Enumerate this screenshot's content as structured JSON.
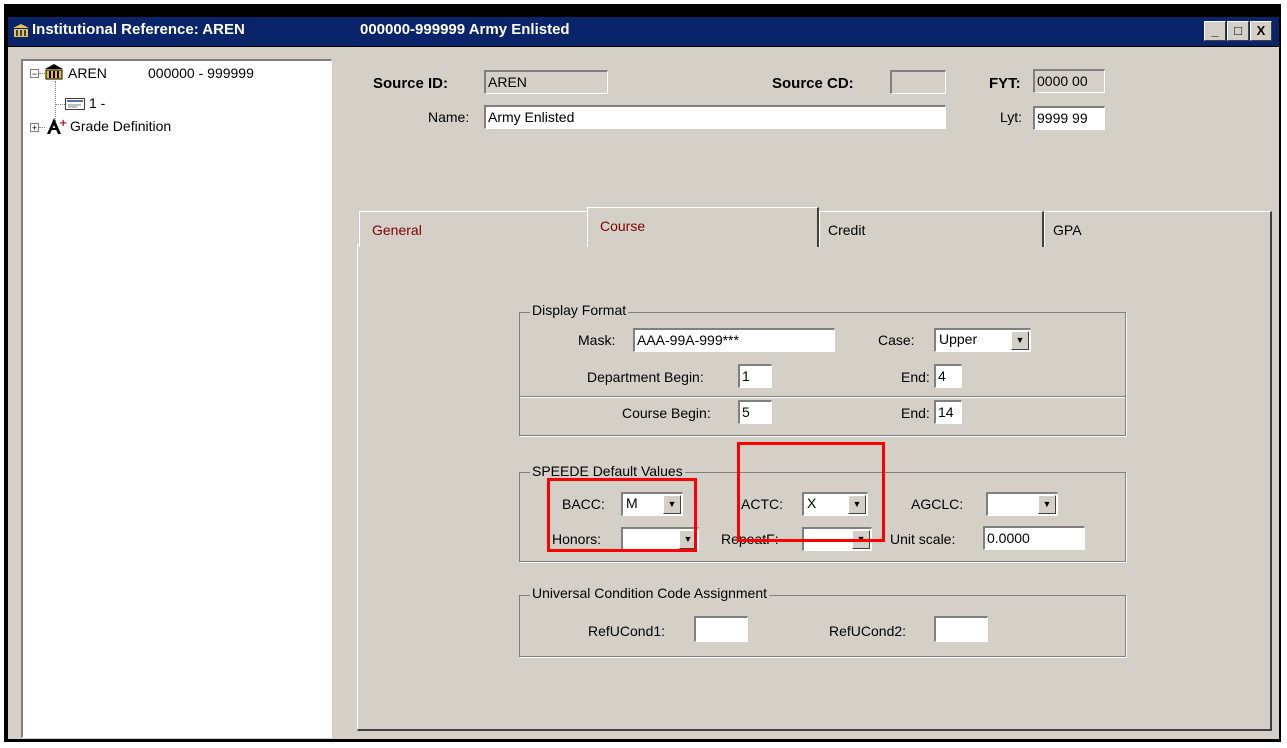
{
  "window": {
    "title_left": "Institutional Reference: AREN",
    "title_right": "000000-999999 Army Enlisted",
    "controls": [
      "_",
      "□",
      "X"
    ]
  },
  "tree": {
    "root_label": "AREN",
    "root_range": "000000 - 999999",
    "child1_label": "1 -",
    "child2_label": "Grade Definition"
  },
  "header": {
    "source_id_label": "Source ID:",
    "source_id_value": "AREN",
    "source_cd_label": "Source CD:",
    "source_cd_value": "",
    "fyt_label": "FYT:",
    "fyt_value": "0000 00",
    "name_label": "Name:",
    "name_value": "Army Enlisted",
    "lyt_label": "Lyt:",
    "lyt_value": "9999 99"
  },
  "tabs": [
    {
      "label": "General"
    },
    {
      "label": "Course"
    },
    {
      "label": "Credit"
    },
    {
      "label": "GPA"
    }
  ],
  "display_format": {
    "title": "Display Format",
    "mask_label": "Mask:",
    "mask_value": "AAA-99A-999***",
    "case_label": "Case:",
    "case_value": "Upper",
    "dept_begin_label": "Department Begin:",
    "dept_begin_value": "1",
    "dept_end_label": "End:",
    "dept_end_value": "4",
    "course_begin_label": "Course Begin:",
    "course_begin_value": "5",
    "course_end_label": "End:",
    "course_end_value": "14"
  },
  "speede": {
    "title": "SPEEDE Default Values",
    "bacc_label": "BACC:",
    "bacc_value": "M",
    "actc_label": "ACTC:",
    "actc_value": "X",
    "agclc_label": "AGCLC:",
    "agclc_value": "",
    "honors_label": "Honors:",
    "honors_value": "",
    "repeatf_label": "RepeatF:",
    "repeatf_value": "",
    "unit_scale_label": "Unit scale:",
    "unit_scale_value": "0.0000"
  },
  "ucc": {
    "title": "Universal Condition Code Assignment",
    "refucond1_label": "RefUCond1:",
    "refucond1_value": "",
    "refucond2_label": "RefUCond2:",
    "refucond2_value": ""
  },
  "colors": {
    "titlebar": "#0a246a",
    "face": "#d4d0c8",
    "tab_text": "#800000",
    "highlight": "#ff0000"
  }
}
